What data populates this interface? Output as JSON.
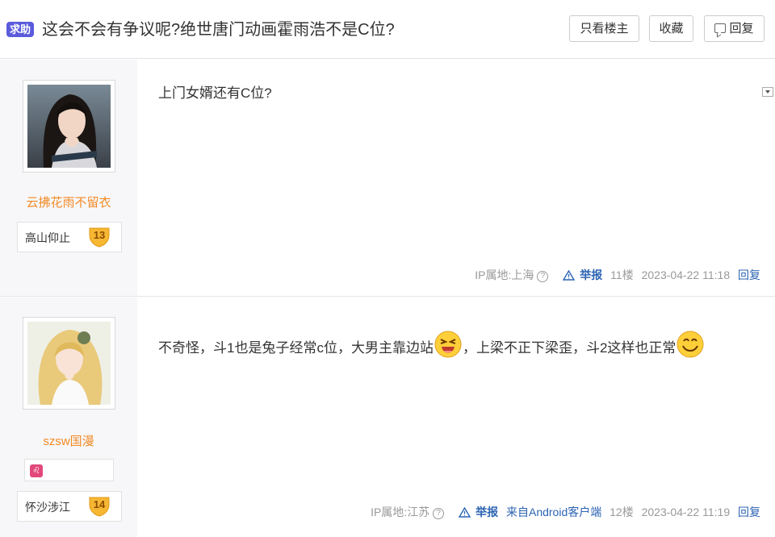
{
  "thread": {
    "tag": "求助",
    "title": "这会不会有争议呢?绝世唐门动画霍雨浩不是C位?",
    "buttons": {
      "only_author": "只看楼主",
      "favorite": "收藏",
      "reply": "回复"
    }
  },
  "posts": [
    {
      "username": "云拂花雨不留衣",
      "level_title": "高山仰止",
      "level": "13",
      "content": "上门女婿还有C位?",
      "ip": "IP属地:上海",
      "report": "举报",
      "floor": "11楼",
      "time": "2023-04-22 11:18",
      "reply": "回复"
    },
    {
      "username": "szsw国漫",
      "level_title": "怀沙涉江",
      "level": "14",
      "content_part1": "不奇怪，斗1也是兔子经常c位，大男主靠边站",
      "content_part2": "，上梁不正下梁歪，斗2这样也正常",
      "ip": "IP属地:江苏",
      "report": "举报",
      "source": "来自Android客户端",
      "floor": "12楼",
      "time": "2023-04-22 11:19",
      "reply": "回复"
    }
  ],
  "colors": {
    "tag_bg": "#5b5bdc",
    "username": "#f28a24",
    "link": "#2d64b3"
  }
}
